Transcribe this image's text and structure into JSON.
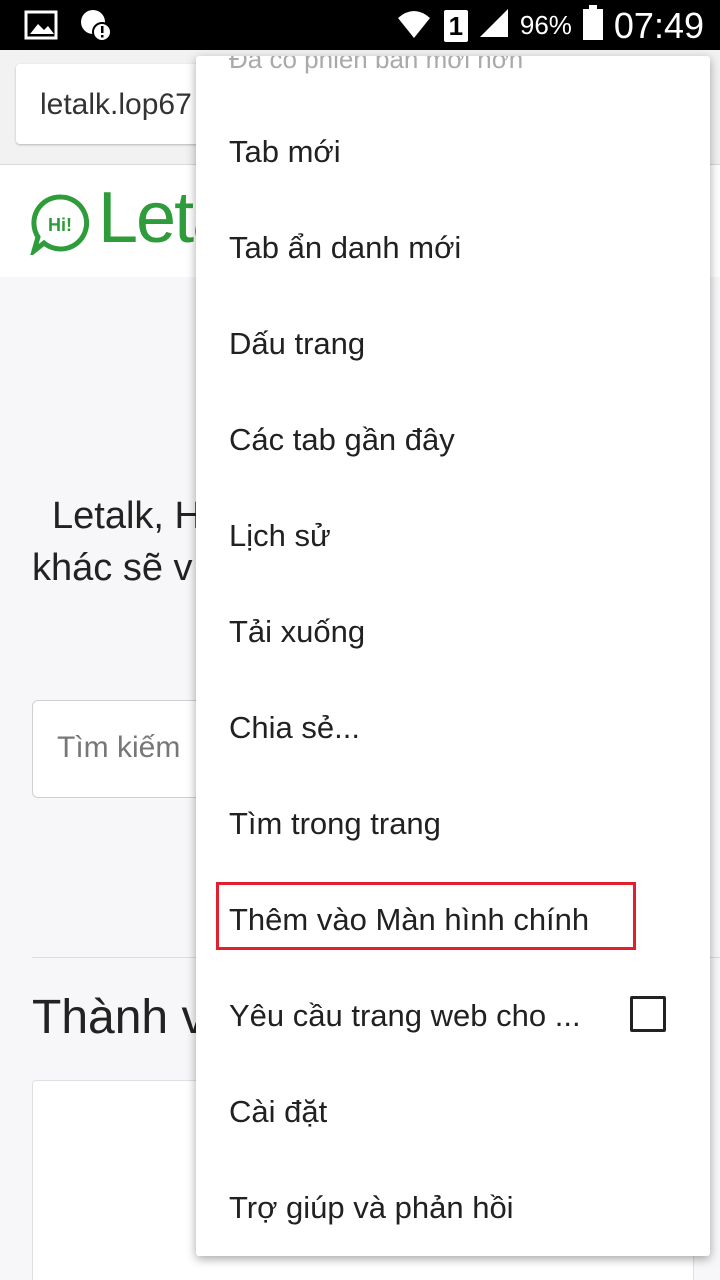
{
  "status_bar": {
    "battery_percent": "96%",
    "time": "07:49",
    "sim_slot": "1",
    "icons": [
      "image-icon",
      "alert-icon",
      "wifi-icon",
      "signal-icon",
      "battery-icon"
    ]
  },
  "browser": {
    "url": "letalk.lop67"
  },
  "page": {
    "logo_text": "Leta",
    "logo_bubble": "Hi!",
    "intro_line1": "Letalk, H",
    "intro_line2": "khác sẽ v",
    "search_placeholder": "Tìm kiếm",
    "section_title": "Thành v"
  },
  "menu": {
    "top_hint": "Đã có phiên bản mới hơn",
    "items": [
      {
        "label": "Tab mới"
      },
      {
        "label": "Tab ẩn danh mới"
      },
      {
        "label": "Dấu trang"
      },
      {
        "label": "Các tab gần đây"
      },
      {
        "label": "Lịch sử"
      },
      {
        "label": "Tải xuống"
      },
      {
        "label": "Chia sẻ..."
      },
      {
        "label": "Tìm trong trang"
      },
      {
        "label": "Thêm vào Màn hình chính"
      },
      {
        "label": "Yêu cầu trang web cho ...",
        "checked": false
      },
      {
        "label": "Cài đặt"
      },
      {
        "label": "Trợ giúp và phản hồi"
      }
    ],
    "highlight_color": "#e0202e"
  }
}
